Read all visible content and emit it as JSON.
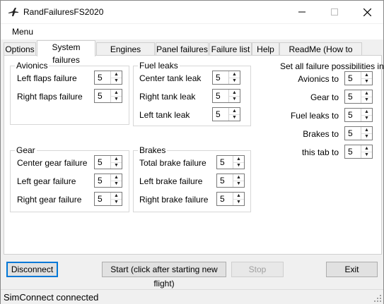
{
  "window": {
    "title": "RandFailuresFS2020"
  },
  "menu": {
    "items": [
      "Menu"
    ]
  },
  "tabs": [
    "Options",
    "System failures",
    "Engines failures",
    "Panel failures",
    "Failure list",
    "Help",
    "ReadMe (How to use)"
  ],
  "active_tab": "System failures",
  "groups": {
    "avionics": {
      "title": "Avionics",
      "rows": [
        {
          "label": "Left flaps failure",
          "value": "5"
        },
        {
          "label": "Right flaps failure",
          "value": "5"
        }
      ]
    },
    "fuel": {
      "title": "Fuel leaks",
      "rows": [
        {
          "label": "Center tank leak",
          "value": "5"
        },
        {
          "label": "Right tank leak",
          "value": "5"
        },
        {
          "label": "Left tank leak",
          "value": "5"
        }
      ]
    },
    "gear": {
      "title": "Gear",
      "rows": [
        {
          "label": "Center gear failure",
          "value": "5"
        },
        {
          "label": "Left gear failure",
          "value": "5"
        },
        {
          "label": "Right gear failure",
          "value": "5"
        }
      ]
    },
    "brakes": {
      "title": "Brakes",
      "rows": [
        {
          "label": "Total brake failure",
          "value": "5"
        },
        {
          "label": "Left brake failure",
          "value": "5"
        },
        {
          "label": "Right brake failure",
          "value": "5"
        }
      ]
    }
  },
  "set_all": {
    "heading": "Set all failure possibilities in",
    "rows": [
      {
        "label": "Avionics to",
        "value": "5"
      },
      {
        "label": "Gear to",
        "value": "5"
      },
      {
        "label": "Fuel leaks to",
        "value": "5"
      },
      {
        "label": "Brakes to",
        "value": "5"
      },
      {
        "label": "this tab to",
        "value": "5"
      }
    ]
  },
  "buttons": {
    "disconnect": "Disconnect",
    "start": "Start (click after starting new flight)",
    "stop": "Stop",
    "exit": "Exit"
  },
  "status": {
    "text": "SimConnect connected"
  }
}
